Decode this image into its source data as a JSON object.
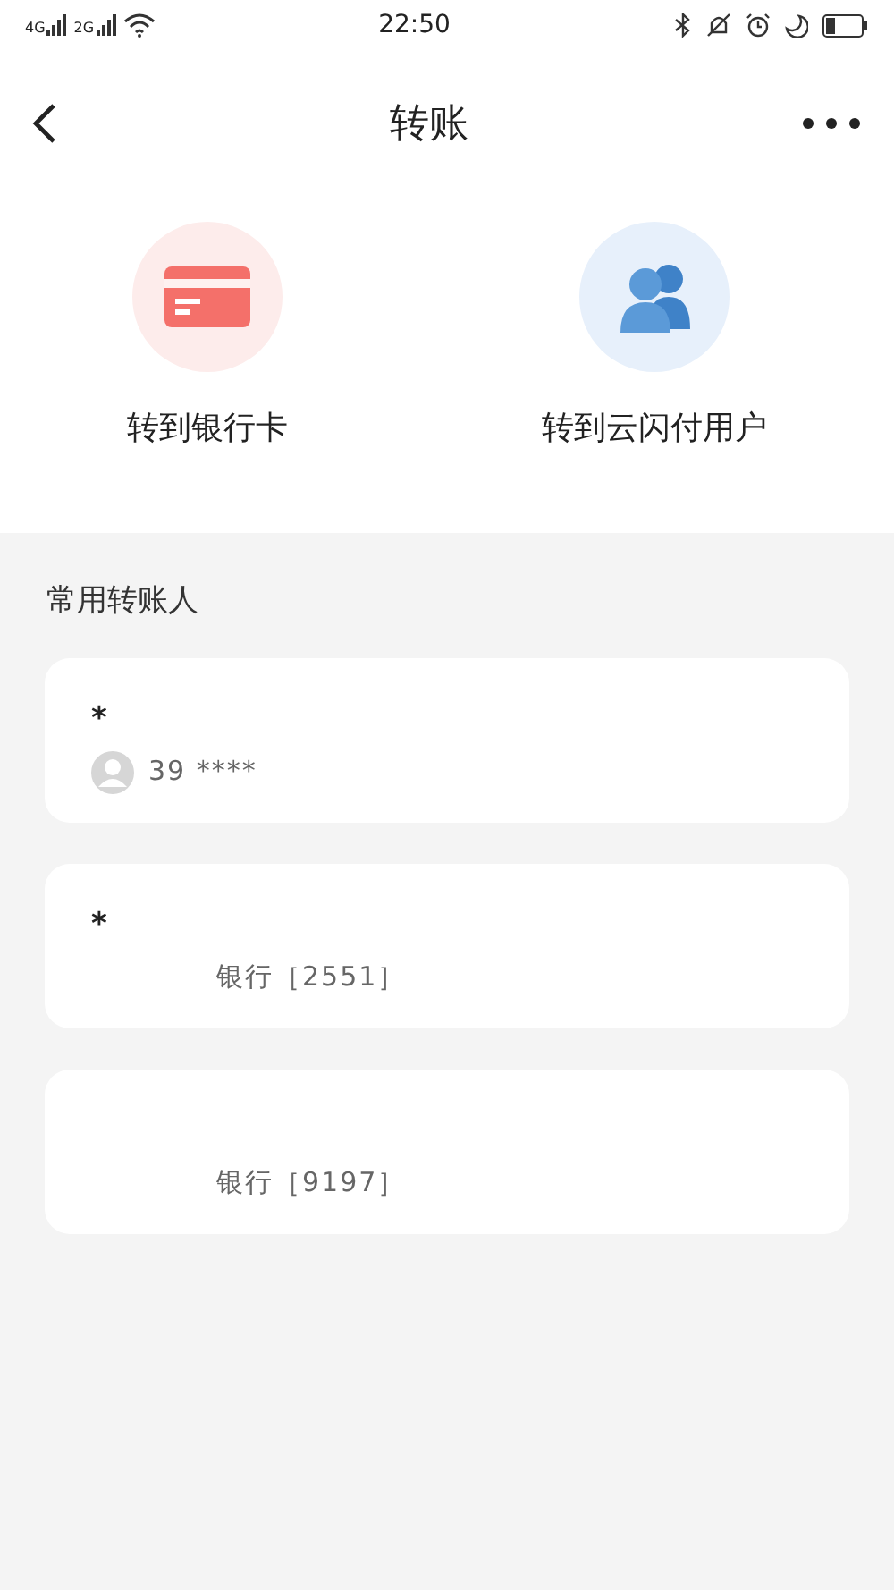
{
  "status_bar": {
    "network_1": "4G",
    "network_2": "2G",
    "time": "22:50"
  },
  "header": {
    "title": "转账"
  },
  "actions": [
    {
      "kind": "bank-card",
      "label": "转到银行卡"
    },
    {
      "kind": "users",
      "label": "转到云闪付用户"
    }
  ],
  "section_title": "常用转账人",
  "payees": [
    {
      "kind": "phone",
      "name": "*",
      "detail": "39 ****"
    },
    {
      "kind": "bank",
      "name": "*",
      "detail": "银行［2551］"
    },
    {
      "kind": "bank",
      "detail": "银行［9197］"
    }
  ]
}
